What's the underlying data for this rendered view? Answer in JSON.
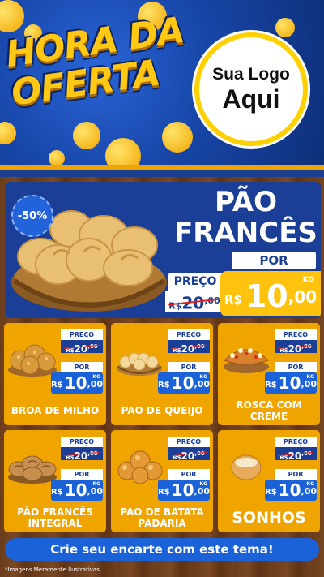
{
  "header": {
    "title_line1": "HORA DA",
    "title_line2": "OFERTA",
    "logo_line1": "Sua Logo",
    "logo_line2": "Aqui"
  },
  "featured": {
    "discount": "-50%",
    "name_line1": "PÃO",
    "name_line2": "FRANCÊS",
    "preco_label": "PREÇO",
    "old_currency": "R$",
    "old_int": "20",
    "old_cents": ",00",
    "por_label": "POR",
    "new_currency": "R$",
    "new_int": "10",
    "new_cents": ",00",
    "unit": "KG"
  },
  "products": [
    {
      "name": "BROA DE MILHO",
      "preco_label": "PREÇO",
      "old_currency": "R$",
      "old_int": "20",
      "old_cents": ",00",
      "por_label": "POR",
      "new_currency": "R$",
      "new_int": "10",
      "new_cents": ",00",
      "unit": "KG"
    },
    {
      "name": "PAO DE QUEIJO",
      "preco_label": "PREÇO",
      "old_currency": "R$",
      "old_int": "20",
      "old_cents": ",00",
      "por_label": "POR",
      "new_currency": "R$",
      "new_int": "10",
      "new_cents": ",00",
      "unit": "KG"
    },
    {
      "name": "ROSCA COM CREME",
      "preco_label": "PREÇO",
      "old_currency": "R$",
      "old_int": "20",
      "old_cents": ",00",
      "por_label": "POR",
      "new_currency": "R$",
      "new_int": "10",
      "new_cents": ",00",
      "unit": "KG"
    },
    {
      "name": "PÃO FRANCÊS INTEGRAL",
      "preco_label": "PREÇO",
      "old_currency": "R$",
      "old_int": "20",
      "old_cents": ",00",
      "por_label": "POR",
      "new_currency": "R$",
      "new_int": "10",
      "new_cents": ",00",
      "unit": "KG"
    },
    {
      "name": "PAO DE BATATA PADARIA",
      "preco_label": "PREÇO",
      "old_currency": "R$",
      "old_int": "20",
      "old_cents": ",00",
      "por_label": "POR",
      "new_currency": "R$",
      "new_int": "10",
      "new_cents": ",00",
      "unit": "KG"
    },
    {
      "name": "SONHOS",
      "preco_label": "PREÇO",
      "old_currency": "R$",
      "old_int": "20",
      "old_cents": ",00",
      "por_label": "POR",
      "new_currency": "R$",
      "new_int": "10",
      "new_cents": ",00",
      "unit": "KG"
    }
  ],
  "footer": {
    "cta": "Crie seu encarte com este tema!",
    "disclaimer": "*Imagens Meramente Ilustrativas"
  },
  "colors": {
    "header_blue": "#1746a8",
    "panel_blue": "#1b3f96",
    "price_blue": "#1b62d8",
    "accent_yellow": "#ffc20e",
    "card_orange": "#f0a400",
    "strike_red": "#e0241b"
  },
  "icons": [
    "bread-basket-image",
    "corn-bread-image",
    "cheese-bread-image",
    "sweet-roll-image",
    "whole-wheat-bread-image",
    "potato-bread-image",
    "donut-image"
  ]
}
